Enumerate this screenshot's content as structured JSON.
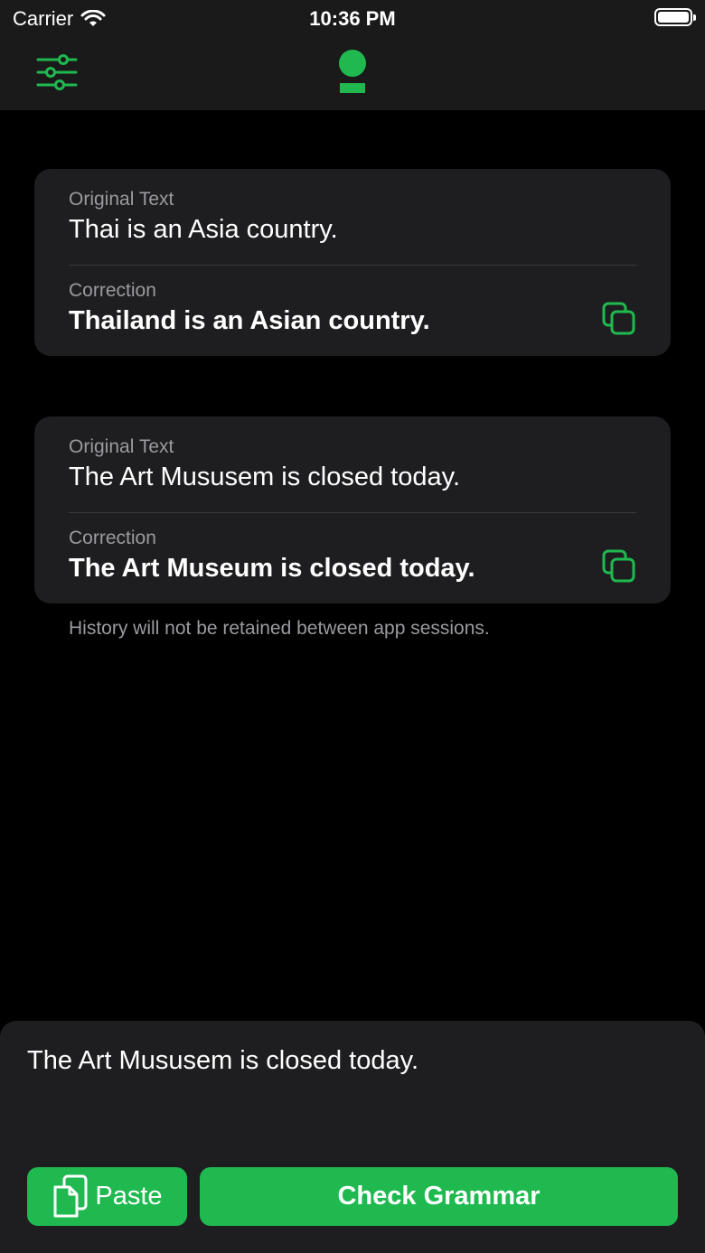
{
  "status_bar": {
    "carrier": "Carrier",
    "time": "10:36 PM"
  },
  "nav": {
    "settings_icon": "sliders-icon",
    "logo_icon": "app-logo-icon"
  },
  "history": {
    "items": [
      {
        "original_label": "Original Text",
        "original": "Thai is an Asia country.",
        "correction_label": "Correction",
        "correction": "Thailand is an Asian country."
      },
      {
        "original_label": "Original Text",
        "original": "The Art Mususem is closed today.",
        "correction_label": "Correction",
        "correction": "The Art Museum is closed today."
      }
    ],
    "notice": "History will not be retained between app sessions."
  },
  "composer": {
    "input_value": "The Art Mususem is closed today.",
    "paste_label": "Paste",
    "check_label": "Check Grammar"
  },
  "colors": {
    "accent": "#1fb950",
    "background": "#000000",
    "card": "#1e1e20"
  }
}
